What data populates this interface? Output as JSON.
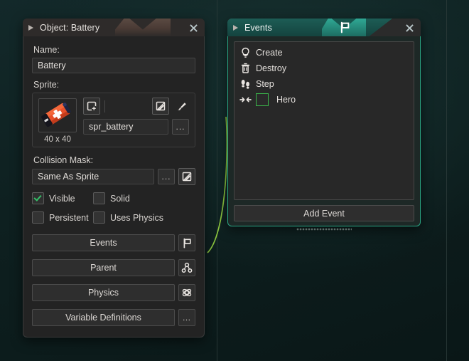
{
  "object_panel": {
    "title": "Object: Battery",
    "collapse_icon": "triangle-left-icon",
    "close_icon": "close-icon",
    "name_label": "Name:",
    "name_value": "Battery",
    "sprite_label": "Sprite:",
    "sprite_name": "spr_battery",
    "sprite_dimensions": "40 x 40",
    "sprite_new_icon": "new-sprite-icon",
    "sprite_edit_icon": "edit-sprite-icon",
    "sprite_paint_icon": "paint-brush-icon",
    "sprite_menu_label": "...",
    "collision_label": "Collision Mask:",
    "collision_value": "Same As Sprite",
    "collision_menu_label": "...",
    "collision_edit_icon": "edit-mask-icon",
    "checkboxes": [
      {
        "label": "Visible",
        "checked": true
      },
      {
        "label": "Solid",
        "checked": false
      },
      {
        "label": "Persistent",
        "checked": false
      },
      {
        "label": "Uses Physics",
        "checked": false
      }
    ],
    "buttons": [
      {
        "label": "Events",
        "icon": "flag-icon"
      },
      {
        "label": "Parent",
        "icon": "parent-node-icon"
      },
      {
        "label": "Physics",
        "icon": "physics-atom-icon"
      },
      {
        "label": "Variable Definitions",
        "icon": "ellipsis-icon"
      }
    ]
  },
  "events_panel": {
    "title": "Events",
    "collapse_icon": "triangle-left-icon",
    "tab_icon": "flag-icon",
    "close_icon": "close-icon",
    "events": [
      {
        "label": "Create",
        "icon": "lightbulb-icon",
        "swatch": false
      },
      {
        "label": "Destroy",
        "icon": "trash-icon",
        "swatch": false
      },
      {
        "label": "Step",
        "icon": "footsteps-icon",
        "swatch": false
      },
      {
        "label": "Hero",
        "icon": "collision-icon",
        "swatch": true
      }
    ],
    "add_event_label": "Add Event",
    "resize_grip": "resize-grip"
  },
  "colors": {
    "accent_teal": "#2aa583",
    "connector_green": "#8cc63f",
    "check_green": "#35c169",
    "swatch_green": "#3ab54a",
    "panel_bg": "#232323",
    "workspace_bg": "#0e2020"
  }
}
